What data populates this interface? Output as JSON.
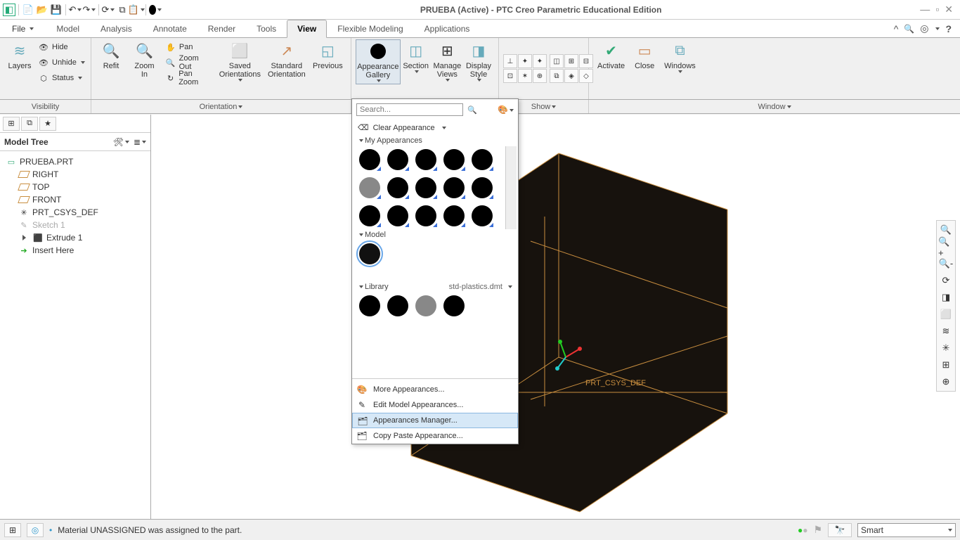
{
  "window": {
    "title": "PRUEBA (Active) - PTC Creo Parametric Educational Edition"
  },
  "ribbon_tabs": {
    "file": "File",
    "tabs": [
      "Model",
      "Analysis",
      "Annotate",
      "Render",
      "Tools",
      "View",
      "Flexible Modeling",
      "Applications"
    ],
    "active": "View"
  },
  "ribbon": {
    "layers_btn": "Layers",
    "hide": "Hide",
    "unhide": "Unhide",
    "status": "Status",
    "refit": "Refit",
    "zoom_in": "Zoom In",
    "pan": "Pan",
    "zoom_out": "Zoom Out",
    "pan_zoom": "Pan Zoom",
    "saved_orient": "Saved\nOrientations",
    "std_orient": "Standard\nOrientation",
    "previous": "Previous",
    "appearance": "Appearance\nGallery",
    "section": "Section",
    "manage_views": "Manage\nViews",
    "display_style": "Display\nStyle",
    "activate": "Activate",
    "close": "Close",
    "windows": "Windows"
  },
  "ribbon_groups": {
    "visibility": "Visibility",
    "orientation": "Orientation",
    "show": "Show",
    "window": "Window"
  },
  "sidebar": {
    "title": "Model Tree"
  },
  "tree": {
    "root": "PRUEBA.PRT",
    "right": "RIGHT",
    "top": "TOP",
    "front": "FRONT",
    "csys": "PRT_CSYS_DEF",
    "sketch": "Sketch 1",
    "extrude": "Extrude 1",
    "insert": "Insert Here"
  },
  "viewport": {
    "csys_label": "PRT_CSYS_DEF"
  },
  "appearance_dd": {
    "search_placeholder": "Search...",
    "clear": "Clear Appearance",
    "my_appearances": "My Appearances",
    "model": "Model",
    "library": "Library",
    "library_file": "std-plastics.dmt",
    "more": "More Appearances...",
    "edit_model": "Edit Model Appearances...",
    "manager": "Appearances Manager...",
    "copy_paste": "Copy Paste Appearance..."
  },
  "status": {
    "msg": "Material UNASSIGNED was assigned to the part.",
    "combo": "Smart"
  }
}
